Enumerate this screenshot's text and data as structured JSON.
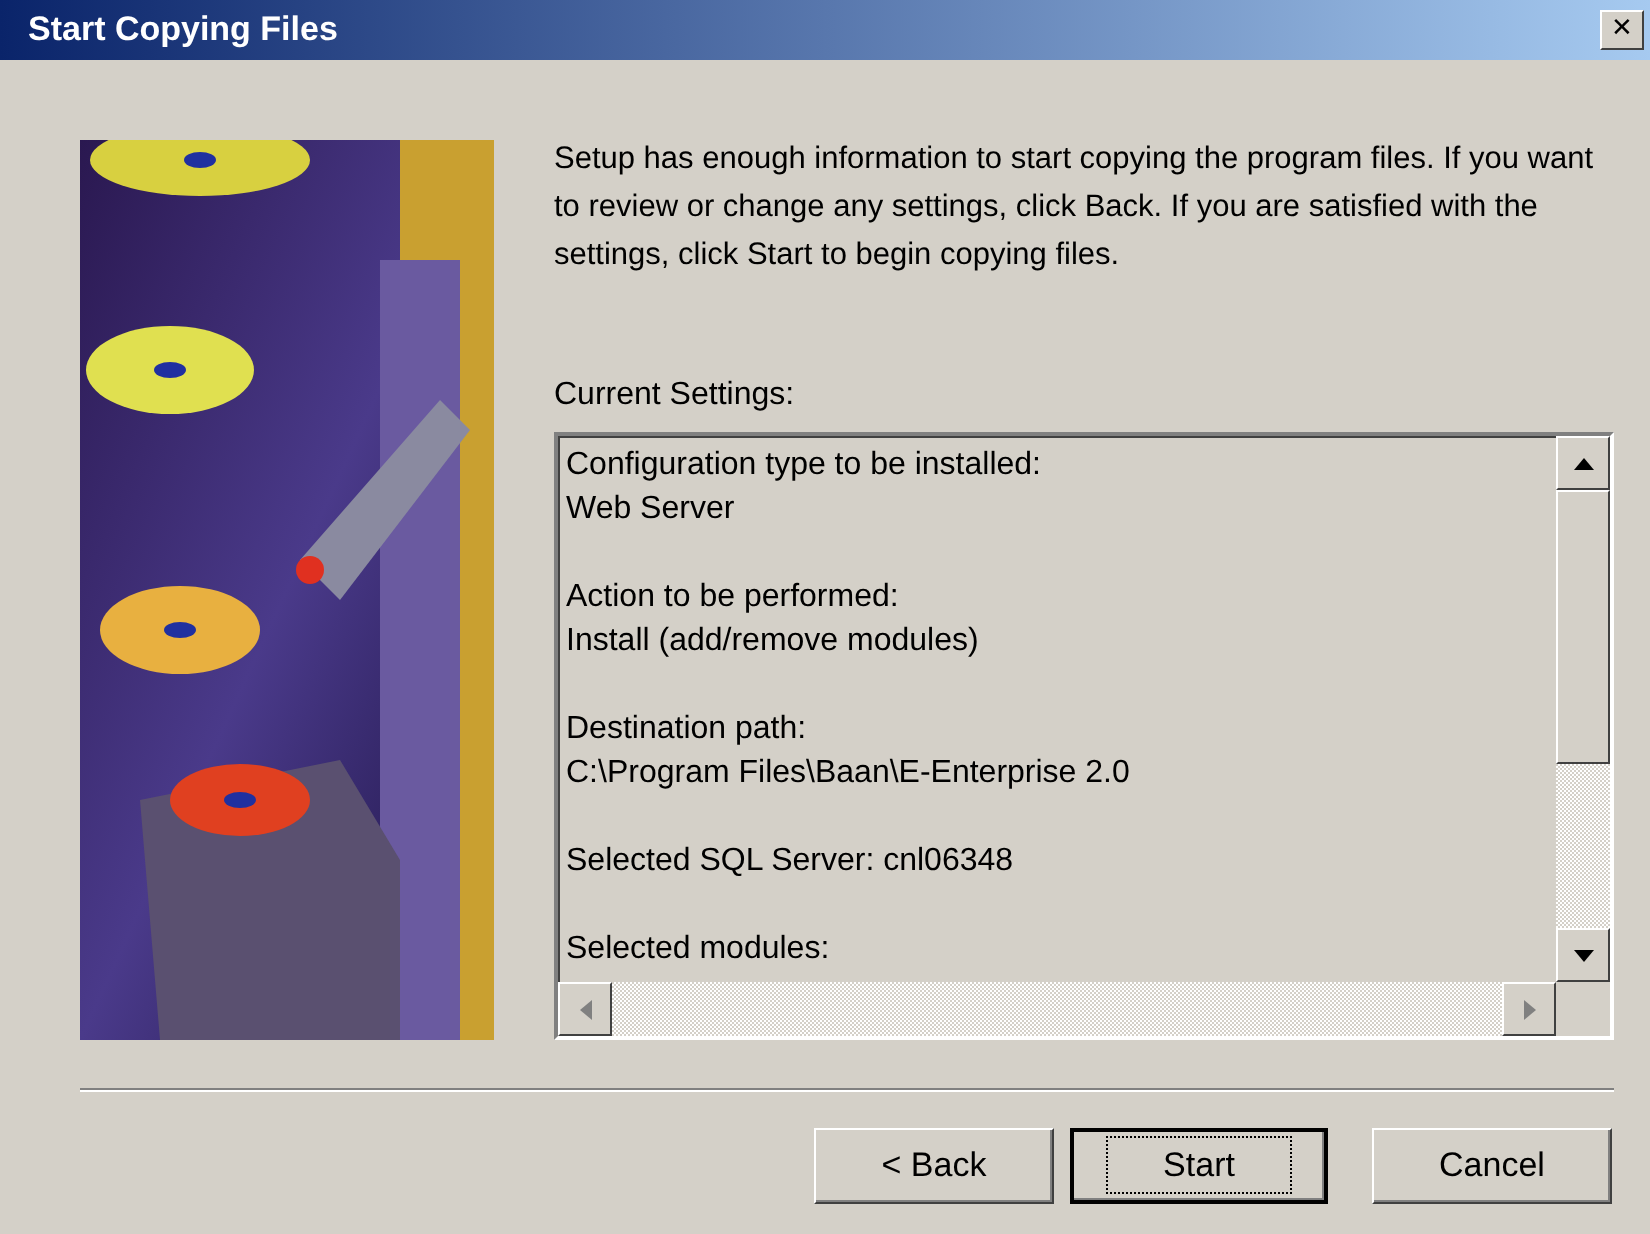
{
  "window": {
    "title": "Start Copying Files",
    "close_glyph": "✕"
  },
  "intro": "Setup has enough information to start copying the program files.  If you want to review or change any settings, click Back.  If you are satisfied with the settings, click Start to begin copying files.",
  "settings_label": "Current Settings:",
  "settings_groups": [
    [
      "Configuration type to be installed:",
      "Web Server"
    ],
    [
      "Action to be performed:",
      "Install (add/remove modules)"
    ],
    [
      "Destination path:",
      "C:\\Program Files\\Baan\\E-Enterprise 2.0"
    ],
    [
      "Selected SQL Server: cnl06348"
    ],
    [
      "Selected modules:"
    ]
  ],
  "buttons": [
    {
      "label": "< Back",
      "default": false
    },
    {
      "label": "Start",
      "default": true
    },
    {
      "label": "Cancel",
      "default": false
    }
  ]
}
